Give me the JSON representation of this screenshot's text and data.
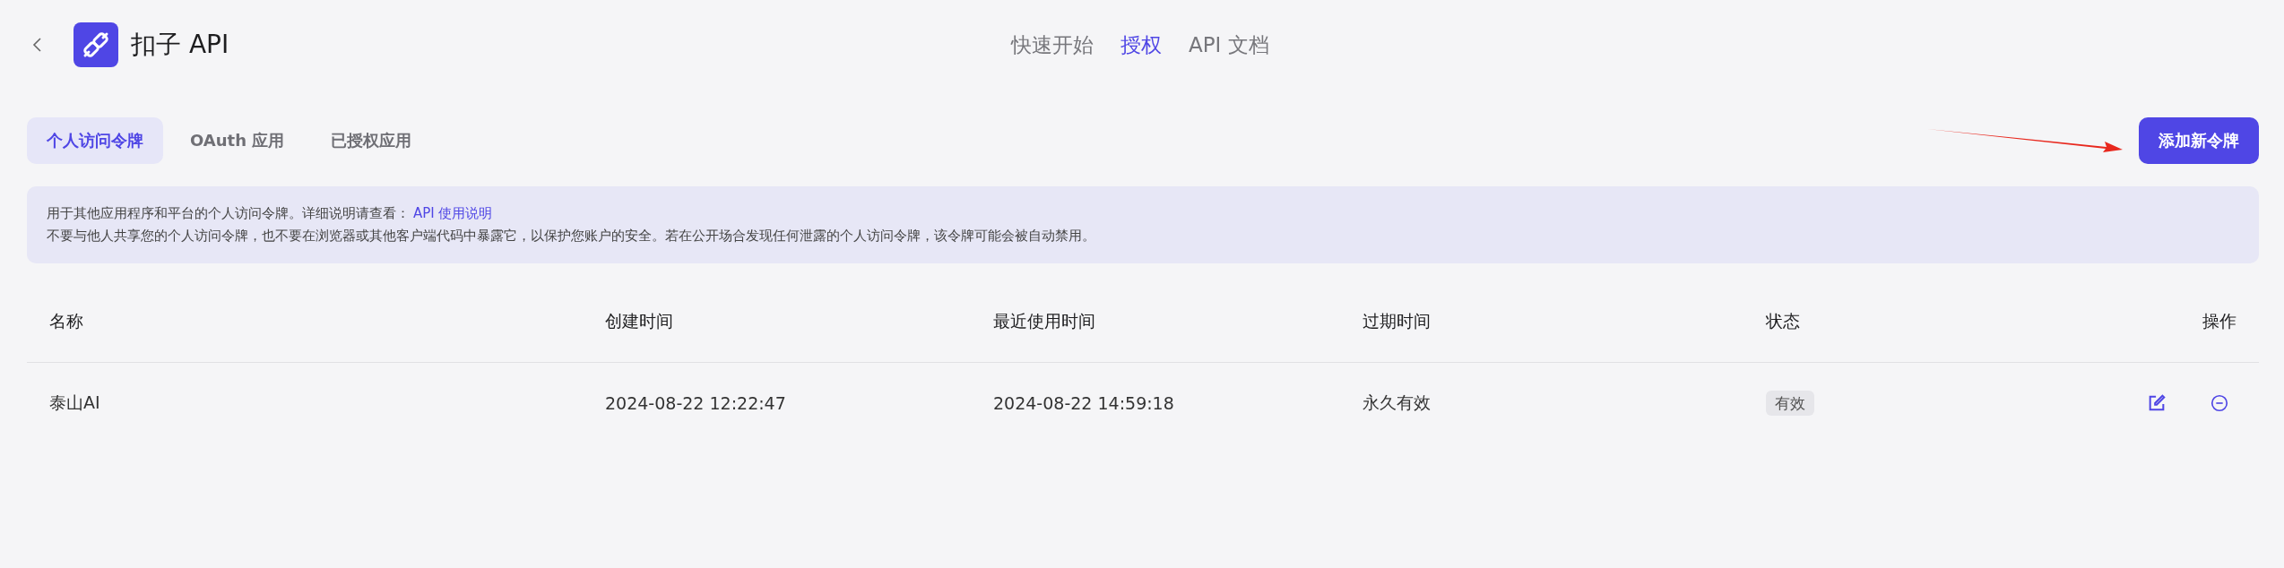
{
  "header": {
    "title": "扣子 API",
    "nav": [
      {
        "label": "快速开始",
        "selected": false
      },
      {
        "label": "授权",
        "selected": true
      },
      {
        "label": "API 文档",
        "selected": false
      }
    ]
  },
  "tabs": [
    {
      "label": "个人访问令牌",
      "selected": true
    },
    {
      "label": "OAuth 应用",
      "selected": false
    },
    {
      "label": "已授权应用",
      "selected": false
    }
  ],
  "add_button": "添加新令牌",
  "notice": {
    "line1": "用于其他应用程序和平台的个人访问令牌。详细说明请查看：",
    "link": "API 使用说明",
    "line2": "不要与他人共享您的个人访问令牌，也不要在浏览器或其他客户端代码中暴露它，以保护您账户的安全。若在公开场合发现任何泄露的个人访问令牌，该令牌可能会被自动禁用。"
  },
  "table": {
    "columns": [
      "名称",
      "创建时间",
      "最近使用时间",
      "过期时间",
      "状态",
      "操作"
    ],
    "rows": [
      {
        "name": "泰山AI",
        "created": "2024-08-22 12:22:47",
        "last_used": "2024-08-22 14:59:18",
        "expires": "永久有效",
        "status": "有效"
      }
    ]
  }
}
